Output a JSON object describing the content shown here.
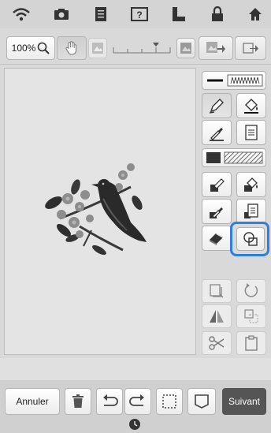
{
  "status_bar": {
    "icons": [
      "wifi-icon",
      "camera-icon",
      "document-icon",
      "help-icon",
      "thread-icon",
      "lock-icon",
      "home-icon"
    ]
  },
  "toolbar": {
    "zoom_value": "100%",
    "icons": [
      "magnifier-icon",
      "hand-pan-icon",
      "image-toggle-icon",
      "ruler-slider-icon",
      "image-fill-icon",
      "image-import-icon",
      "export-icon"
    ]
  },
  "side_panel": {
    "icons": [
      "line-stitch-preview-icon",
      "pen-icon",
      "line-bucket-icon",
      "line-eyedropper-icon",
      "line-list-icon",
      "region-fill-preview-icon",
      "brush-icon",
      "region-bucket-icon",
      "region-eyedropper-icon",
      "region-list-icon",
      "eraser-icon",
      "stamp-shapes-icon",
      "select-area-icon",
      "rotate-icon",
      "mirror-icon",
      "duplicate-icon",
      "cut-icon",
      "paste-icon"
    ]
  },
  "bottom_bar": {
    "cancel_label": "Annuler",
    "next_label": "Suivant",
    "icons": [
      "trash-icon",
      "undo-icon",
      "redo-icon",
      "select-all-icon",
      "shape-icon",
      "clock-icon"
    ]
  },
  "colors": {
    "accent_highlight": "#2f7fe0",
    "next_button": "#555555",
    "background": "#d9d9d9"
  }
}
